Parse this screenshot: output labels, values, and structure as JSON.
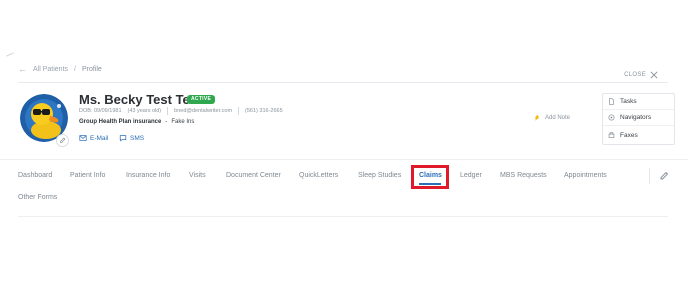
{
  "breadcrumb": {
    "root": "All Patients",
    "separator": "/",
    "current": "Profile"
  },
  "close_label": "CLOSE",
  "patient": {
    "name": "Ms. Becky Test Test",
    "status": "ACTIVE",
    "dob": "DOB: 09/09/1981",
    "age": "(43 years old)",
    "email": "bned@dentalwriter.com",
    "phone": "(561) 316-2665",
    "insurance_plan": "Group Health Plan insurance",
    "insurance_dash": "-",
    "insurance_company": "Fake Ins"
  },
  "contact": {
    "email_label": "E-Mail",
    "sms_label": "SMS"
  },
  "add_note_label": "Add Note",
  "side_panel": [
    "Tasks",
    "Navigators",
    "Faxes"
  ],
  "tabs": [
    "Dashboard",
    "Patient Info",
    "Insurance Info",
    "Visits",
    "Document Center",
    "QuickLetters",
    "Sleep Studies",
    "Claims",
    "Ledger",
    "MBS Requests",
    "Appointments",
    "Other Forms"
  ],
  "active_tab": "Claims",
  "colors": {
    "accent": "#2a6fb8",
    "status_green": "#2fa84f",
    "highlight_red": "#e01a2b"
  }
}
